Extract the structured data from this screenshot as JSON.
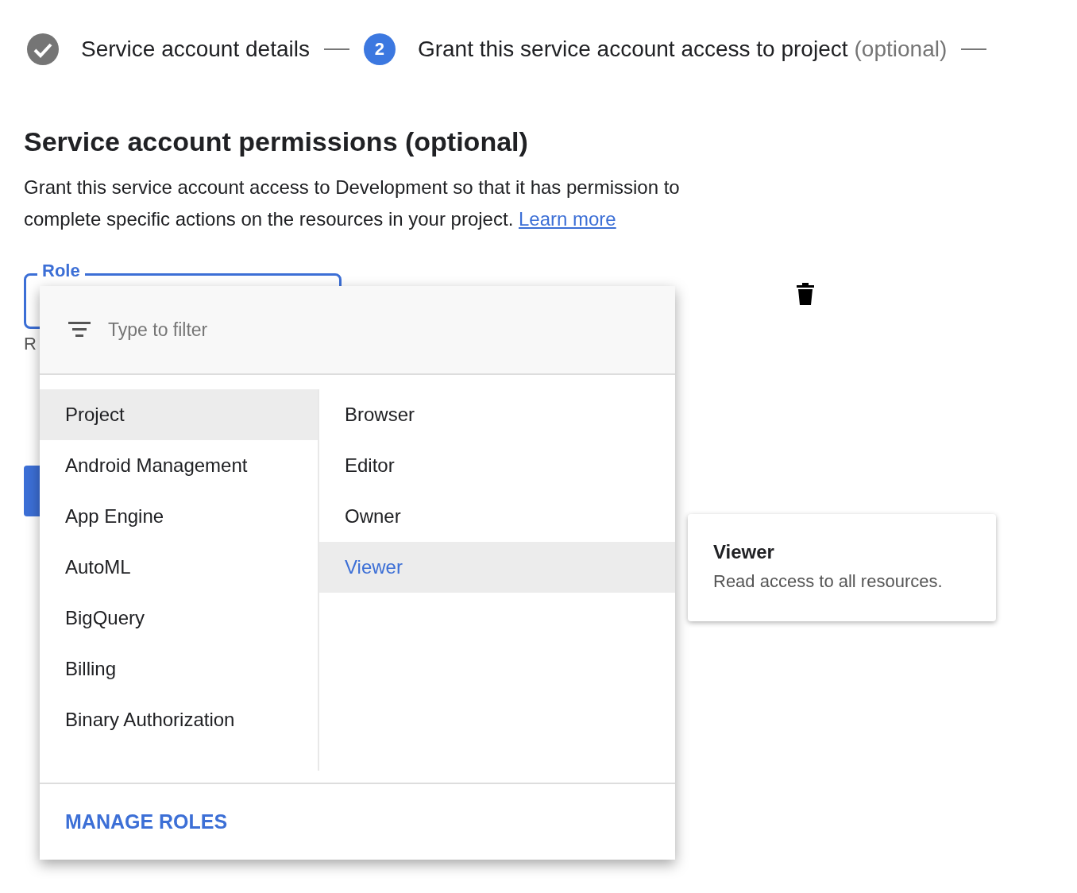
{
  "stepper": [
    {
      "kind": "done",
      "label": "Service account details"
    },
    {
      "kind": "current",
      "number": "2",
      "label": "Grant this service account access to project",
      "suffix": "(optional)"
    }
  ],
  "section": {
    "title": "Service account permissions (optional)",
    "description": "Grant this service account access to Development so that it has permission to complete specific actions on the resources in your project.",
    "link": "Learn more"
  },
  "role_field": {
    "label": "Role",
    "helper": "R"
  },
  "role_menu": {
    "filter_placeholder": "Type to filter",
    "categories": [
      {
        "label": "Project",
        "selected": true
      },
      {
        "label": "Android Management",
        "selected": false
      },
      {
        "label": "App Engine",
        "selected": false
      },
      {
        "label": "AutoML",
        "selected": false
      },
      {
        "label": "BigQuery",
        "selected": false
      },
      {
        "label": "Billing",
        "selected": false
      },
      {
        "label": "Binary Authorization",
        "selected": false
      }
    ],
    "roles": [
      {
        "label": "Browser",
        "selected": false
      },
      {
        "label": "Editor",
        "selected": false
      },
      {
        "label": "Owner",
        "selected": false
      },
      {
        "label": "Viewer",
        "selected": true
      }
    ],
    "footer_action": "MANAGE ROLES"
  },
  "role_tooltip": {
    "title": "Viewer",
    "description": "Read access to all resources."
  }
}
